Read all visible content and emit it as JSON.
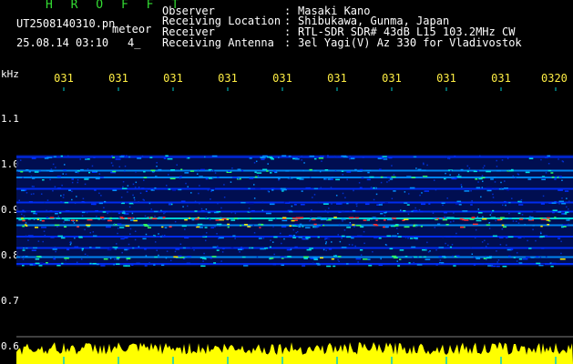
{
  "header": {
    "title": "H R O F F T",
    "filename": "UT2508140310.pn",
    "tag": "meteor",
    "datetime": "25.08.14 03:10",
    "count": "4_"
  },
  "metadata": [
    {
      "label": "Observer",
      "value": "Masaki Kano"
    },
    {
      "label": "Receiving Location",
      "value": "Shibukawa, Gunma, Japan"
    },
    {
      "label": "Receiver",
      "value": "RTL-SDR SDR# 43dB L15 103.2MHz CW"
    },
    {
      "label": "Receiving Antenna",
      "value": "3el Yagi(V) Az 330 for Vladivostok"
    }
  ],
  "chart_data": {
    "type": "heatmap",
    "ylabel": "kHz",
    "y_ticks": [
      "1.1",
      "1.0",
      "0.9",
      "0.8",
      "0.7",
      "0.6"
    ],
    "x_ticks": [
      "031",
      "031",
      "031",
      "031",
      "031",
      "031",
      "031",
      "031",
      "031",
      "0320"
    ],
    "ylim": [
      0.6,
      1.15
    ],
    "bands": [
      {
        "freq": 1.015,
        "intensity": 0.45
      },
      {
        "freq": 0.985,
        "intensity": 0.55
      },
      {
        "freq": 0.97,
        "intensity": 0.5
      },
      {
        "freq": 0.945,
        "intensity": 0.35
      },
      {
        "freq": 0.915,
        "intensity": 0.4
      },
      {
        "freq": 0.895,
        "intensity": 0.45
      },
      {
        "freq": 0.88,
        "intensity": 0.95
      },
      {
        "freq": 0.865,
        "intensity": 0.7
      },
      {
        "freq": 0.84,
        "intensity": 0.45
      },
      {
        "freq": 0.815,
        "intensity": 0.4
      },
      {
        "freq": 0.795,
        "intensity": 0.6
      },
      {
        "freq": 0.78,
        "intensity": 0.45
      }
    ],
    "colors": {
      "text": "#ffffff",
      "ticks": "#ffee44",
      "noise": "#ffff00",
      "grid": "#00cccc"
    }
  }
}
